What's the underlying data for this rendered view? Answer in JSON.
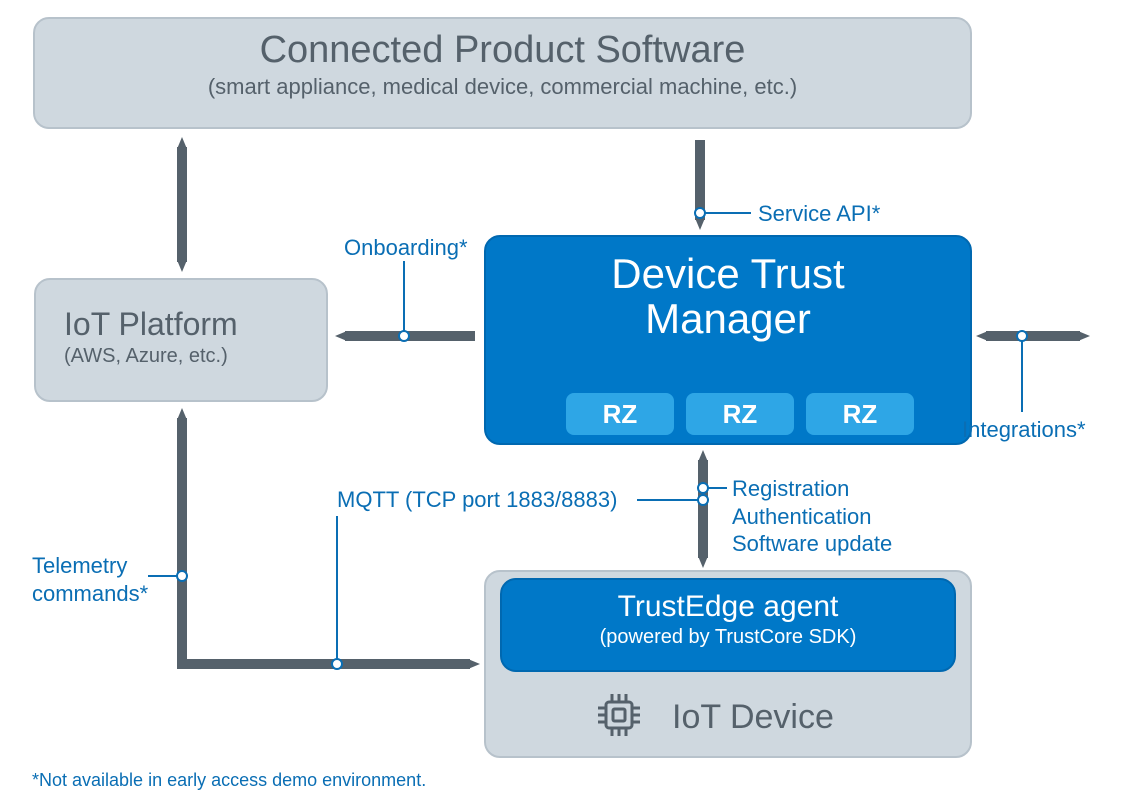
{
  "boxes": {
    "connected_product": {
      "title": "Connected Product Software",
      "subtitle": "(smart appliance, medical device, commercial machine, etc.)"
    },
    "iot_platform": {
      "title": "IoT Platform",
      "subtitle": "(AWS, Azure, etc.)"
    },
    "device_trust_manager": {
      "title_line1": "Device Trust",
      "title_line2": "Manager",
      "rz_labels": [
        "RZ",
        "RZ",
        "RZ"
      ]
    },
    "trustedge": {
      "title": "TrustEdge agent",
      "subtitle": "(powered by TrustCore SDK)"
    },
    "iot_device": {
      "label": "IoT Device"
    }
  },
  "arrows": {
    "service_api": "Service API*",
    "onboarding": "Onboarding*",
    "integrations": "Integrations*",
    "mqtt": "MQTT (TCP port 1883/8883)",
    "telemetry": "Telemetry\ncommands*",
    "dtm_te": {
      "line1": "Registration",
      "line2": "Authentication",
      "line3": "Software update"
    }
  },
  "footnote": "*Not available in early access demo environment."
}
